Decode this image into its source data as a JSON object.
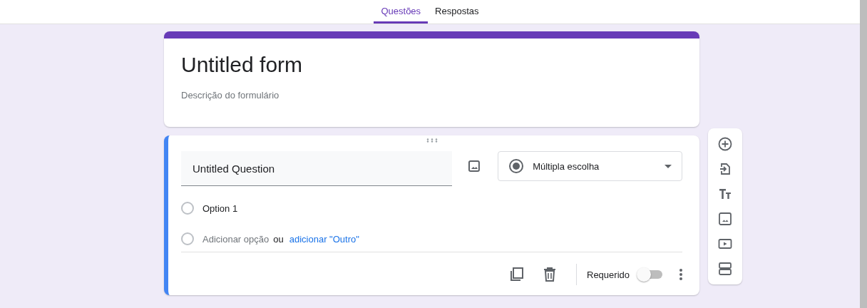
{
  "tabs": [
    {
      "label": "Questões",
      "selected": true
    },
    {
      "label": "Respostas",
      "selected": false
    }
  ],
  "form": {
    "title": "Untitled form",
    "description": "Descrição do formulário"
  },
  "question": {
    "title": "Untitled Question",
    "type": "Múltipla escolha",
    "options": [
      {
        "kind": "option",
        "checked": false,
        "label": "Option 1"
      },
      {
        "kind": "add",
        "checked": false,
        "label": "Adicionar opção",
        "joiner": "ou",
        "link": "adicionar \"Outro\""
      }
    ],
    "required": {
      "label": "Requerido",
      "on": false
    }
  },
  "toolbar": [
    {
      "kind": "add"
    },
    {
      "kind": "import"
    },
    {
      "kind": "title"
    },
    {
      "kind": "image"
    },
    {
      "kind": "video"
    },
    {
      "kind": "section"
    }
  ]
}
